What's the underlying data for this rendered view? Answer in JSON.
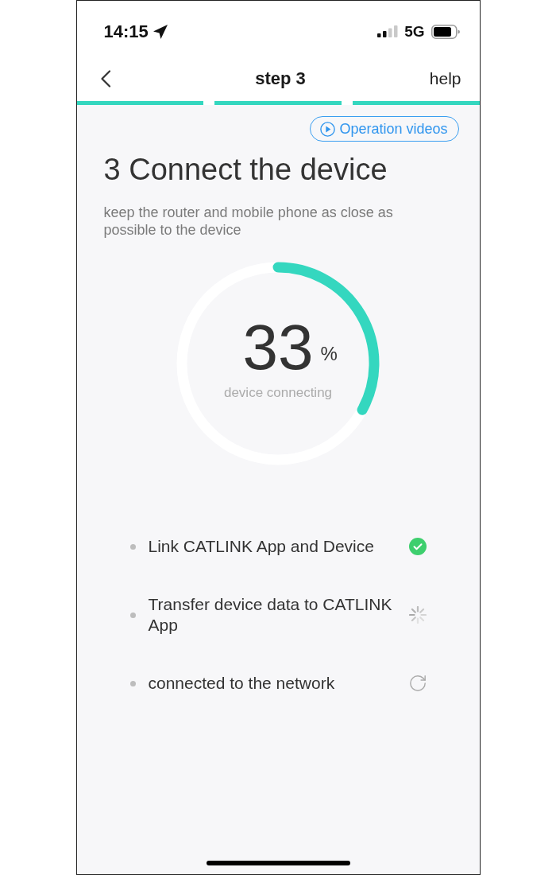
{
  "status_bar": {
    "time": "14:15",
    "network": "5G"
  },
  "nav": {
    "title": "step 3",
    "action": "help"
  },
  "progress_segments": [
    {
      "done": true
    },
    {
      "done": true
    },
    {
      "done": true
    }
  ],
  "video_button": {
    "label": "Operation videos"
  },
  "heading": "3 Connect the device",
  "hint": "keep the router and mobile phone as close as possible to the device",
  "ring": {
    "value": "33",
    "unit": "%",
    "caption": "device connecting"
  },
  "steps": [
    {
      "label": "Link CATLINK App and Device",
      "kind": "done"
    },
    {
      "label": "Transfer device data to CATLINK App",
      "kind": "loading"
    },
    {
      "label": "connected to the network",
      "kind": "pending"
    }
  ]
}
